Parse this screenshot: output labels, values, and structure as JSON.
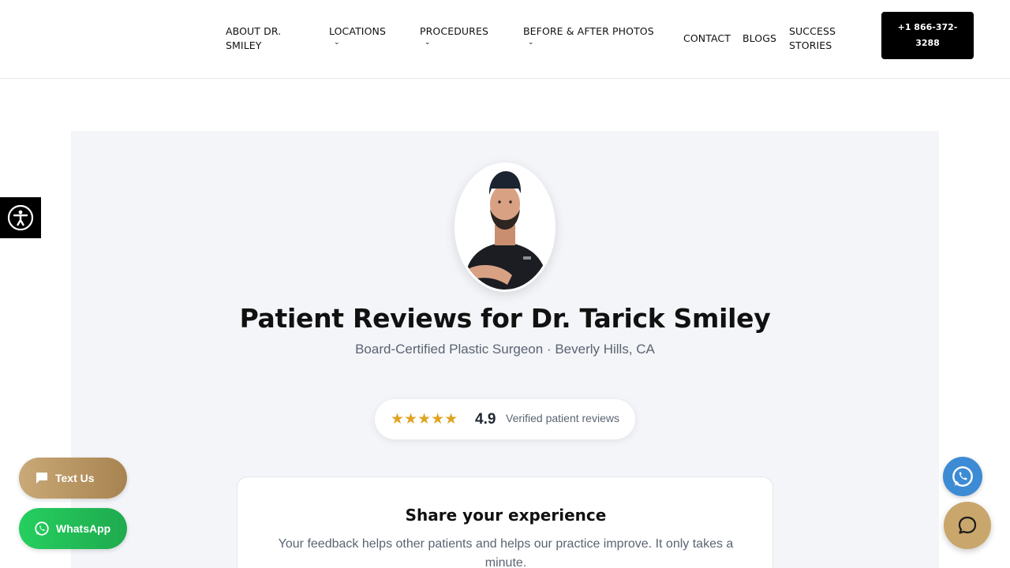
{
  "page": {
    "stray_markup": "\">"
  },
  "nav": {
    "items": [
      {
        "label": "ABOUT DR. SMILEY",
        "has_dropdown": false
      },
      {
        "label": "LOCATIONS",
        "has_dropdown": true
      },
      {
        "label": "PROCEDURES",
        "has_dropdown": true
      },
      {
        "label": "BEFORE & AFTER PHOTOS",
        "has_dropdown": true
      },
      {
        "label": "CONTACT",
        "has_dropdown": false
      },
      {
        "label": "BLOGS",
        "has_dropdown": false
      },
      {
        "label": "SUCCESS STORIES",
        "has_dropdown": false
      }
    ],
    "phone_label": "+1 866-372-3288",
    "dropdown_icon": "chevron-down-icon"
  },
  "accessibility": {
    "icon": "accessibility-icon"
  },
  "hero": {
    "title": "Patient Reviews for Dr. Tarick Smiley",
    "subtitle": "Board-Certified Plastic Surgeon · Beverly Hills, CA",
    "avatar_icon": "doctor-portrait"
  },
  "rating": {
    "stars": "★★★★★",
    "value": "4.9",
    "label": "Verified patient reviews",
    "star_color": "#e0a424"
  },
  "feedback_card": {
    "title": "Share your experience",
    "text": "Your feedback helps other patients and helps our practice improve. It only takes a minute."
  },
  "floating": {
    "text_us_label": "Text Us",
    "whatsapp_label": "WhatsApp",
    "text_us_icon": "chat-bubble-icon",
    "whatsapp_icon": "whatsapp-icon",
    "whatsapp_circle_icon": "whatsapp-icon",
    "chat_icon": "chat-icon"
  },
  "colors": {
    "brand_gold": "#c9a66b",
    "whatsapp_green": "#25cf5f",
    "whatsapp_blue": "#3d8bd4",
    "call_button": "#000000"
  }
}
